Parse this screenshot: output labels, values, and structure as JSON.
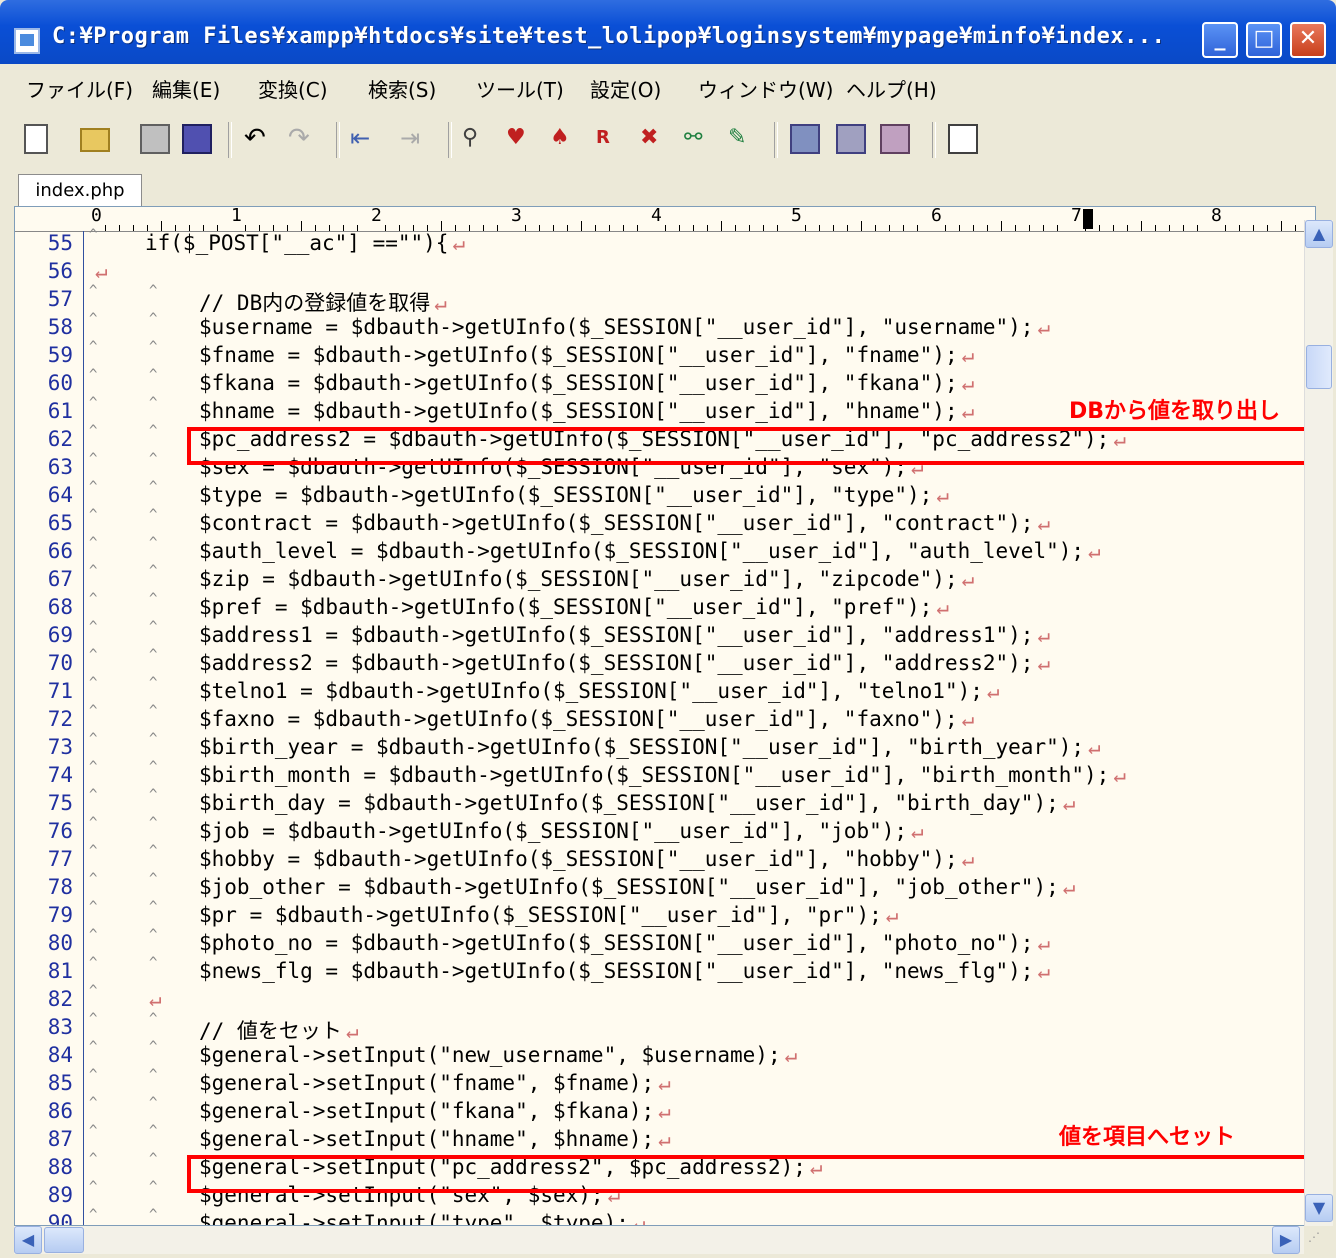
{
  "window": {
    "title": "C:¥Program Files¥xampp¥htdocs¥site¥test_lolipop¥loginsystem¥mypage¥minfo¥index...",
    "minimize": "_",
    "maximize": "□",
    "close": "✕"
  },
  "menu": [
    "ファイル(F)",
    "編集(E)",
    "変換(C)",
    "検索(S)",
    "ツール(T)",
    "設定(O)",
    "ウィンドウ(W)",
    "ヘルプ(H)"
  ],
  "toolbar": {
    "icons": [
      "new-file-icon",
      "open-folder-icon",
      "save-icon",
      "save-all-icon",
      "undo-icon",
      "redo-icon",
      "jump-back-icon",
      "jump-forward-icon",
      "find-icon",
      "find-prev-icon",
      "find-next-icon",
      "replace-icon",
      "grep-icon",
      "compare-icon",
      "mark-icon",
      "macro-record-icon",
      "macro-run-icon",
      "macro-edit-icon",
      "properties-icon"
    ]
  },
  "tab": {
    "label": "index.php"
  },
  "ruler": [
    "0",
    "1",
    "2",
    "3",
    "4",
    "5",
    "6",
    "7",
    "8"
  ],
  "code_lines": [
    {
      "n": "55",
      "indent": 1,
      "text": "if($_POST[\"__ac\"] ==\"\"){"
    },
    {
      "n": "56",
      "indent": 0,
      "text": ""
    },
    {
      "n": "57",
      "indent": 2,
      "text": "// DB内の登録値を取得"
    },
    {
      "n": "58",
      "indent": 2,
      "text": "$username = $dbauth->getUInfo($_SESSION[\"__user_id\"], \"username\");"
    },
    {
      "n": "59",
      "indent": 2,
      "text": "$fname = $dbauth->getUInfo($_SESSION[\"__user_id\"], \"fname\");"
    },
    {
      "n": "60",
      "indent": 2,
      "text": "$fkana = $dbauth->getUInfo($_SESSION[\"__user_id\"], \"fkana\");"
    },
    {
      "n": "61",
      "indent": 2,
      "text": "$hname = $dbauth->getUInfo($_SESSION[\"__user_id\"], \"hname\");"
    },
    {
      "n": "62",
      "indent": 2,
      "text": "$pc_address2 = $dbauth->getUInfo($_SESSION[\"__user_id\"], \"pc_address2\");"
    },
    {
      "n": "63",
      "indent": 2,
      "text": "$sex = $dbauth->getUInfo($_SESSION[\"__user_id\"], \"sex\");"
    },
    {
      "n": "64",
      "indent": 2,
      "text": "$type = $dbauth->getUInfo($_SESSION[\"__user_id\"], \"type\");"
    },
    {
      "n": "65",
      "indent": 2,
      "text": "$contract = $dbauth->getUInfo($_SESSION[\"__user_id\"], \"contract\");"
    },
    {
      "n": "66",
      "indent": 2,
      "text": "$auth_level = $dbauth->getUInfo($_SESSION[\"__user_id\"], \"auth_level\");"
    },
    {
      "n": "67",
      "indent": 2,
      "text": "$zip = $dbauth->getUInfo($_SESSION[\"__user_id\"], \"zipcode\");"
    },
    {
      "n": "68",
      "indent": 2,
      "text": "$pref = $dbauth->getUInfo($_SESSION[\"__user_id\"], \"pref\");"
    },
    {
      "n": "69",
      "indent": 2,
      "text": "$address1 = $dbauth->getUInfo($_SESSION[\"__user_id\"], \"address1\");"
    },
    {
      "n": "70",
      "indent": 2,
      "text": "$address2 = $dbauth->getUInfo($_SESSION[\"__user_id\"], \"address2\");"
    },
    {
      "n": "71",
      "indent": 2,
      "text": "$telno1 = $dbauth->getUInfo($_SESSION[\"__user_id\"], \"telno1\");"
    },
    {
      "n": "72",
      "indent": 2,
      "text": "$faxno = $dbauth->getUInfo($_SESSION[\"__user_id\"], \"faxno\");"
    },
    {
      "n": "73",
      "indent": 2,
      "text": "$birth_year = $dbauth->getUInfo($_SESSION[\"__user_id\"], \"birth_year\");"
    },
    {
      "n": "74",
      "indent": 2,
      "text": "$birth_month = $dbauth->getUInfo($_SESSION[\"__user_id\"], \"birth_month\");"
    },
    {
      "n": "75",
      "indent": 2,
      "text": "$birth_day = $dbauth->getUInfo($_SESSION[\"__user_id\"], \"birth_day\");"
    },
    {
      "n": "76",
      "indent": 2,
      "text": "$job = $dbauth->getUInfo($_SESSION[\"__user_id\"], \"job\");"
    },
    {
      "n": "77",
      "indent": 2,
      "text": "$hobby = $dbauth->getUInfo($_SESSION[\"__user_id\"], \"hobby\");"
    },
    {
      "n": "78",
      "indent": 2,
      "text": "$job_other = $dbauth->getUInfo($_SESSION[\"__user_id\"], \"job_other\");"
    },
    {
      "n": "79",
      "indent": 2,
      "text": "$pr = $dbauth->getUInfo($_SESSION[\"__user_id\"], \"pr\");"
    },
    {
      "n": "80",
      "indent": 2,
      "text": "$photo_no = $dbauth->getUInfo($_SESSION[\"__user_id\"], \"photo_no\");"
    },
    {
      "n": "81",
      "indent": 2,
      "text": "$news_flg = $dbauth->getUInfo($_SESSION[\"__user_id\"], \"news_flg\");"
    },
    {
      "n": "82",
      "indent": 1,
      "text": ""
    },
    {
      "n": "83",
      "indent": 2,
      "text": "// 値をセット"
    },
    {
      "n": "84",
      "indent": 2,
      "text": "$general->setInput(\"new_username\", $username);"
    },
    {
      "n": "85",
      "indent": 2,
      "text": "$general->setInput(\"fname\", $fname);"
    },
    {
      "n": "86",
      "indent": 2,
      "text": "$general->setInput(\"fkana\", $fkana);"
    },
    {
      "n": "87",
      "indent": 2,
      "text": "$general->setInput(\"hname\", $hname);"
    },
    {
      "n": "88",
      "indent": 2,
      "text": "$general->setInput(\"pc_address2\", $pc_address2);"
    },
    {
      "n": "89",
      "indent": 2,
      "text": "$general->setInput(\"sex\", $sex);"
    },
    {
      "n": "90",
      "indent": 2,
      "text": "$general->setInput(\"type\", $type);"
    }
  ],
  "eol_mark": "↵",
  "annotations": {
    "db_fetch": "DBから値を取り出し",
    "set_value": "値を項目へセット"
  },
  "colors": {
    "highlight": "#FF0000",
    "line_number": "#2030A0",
    "editor_bg": "#FFFBF0"
  }
}
